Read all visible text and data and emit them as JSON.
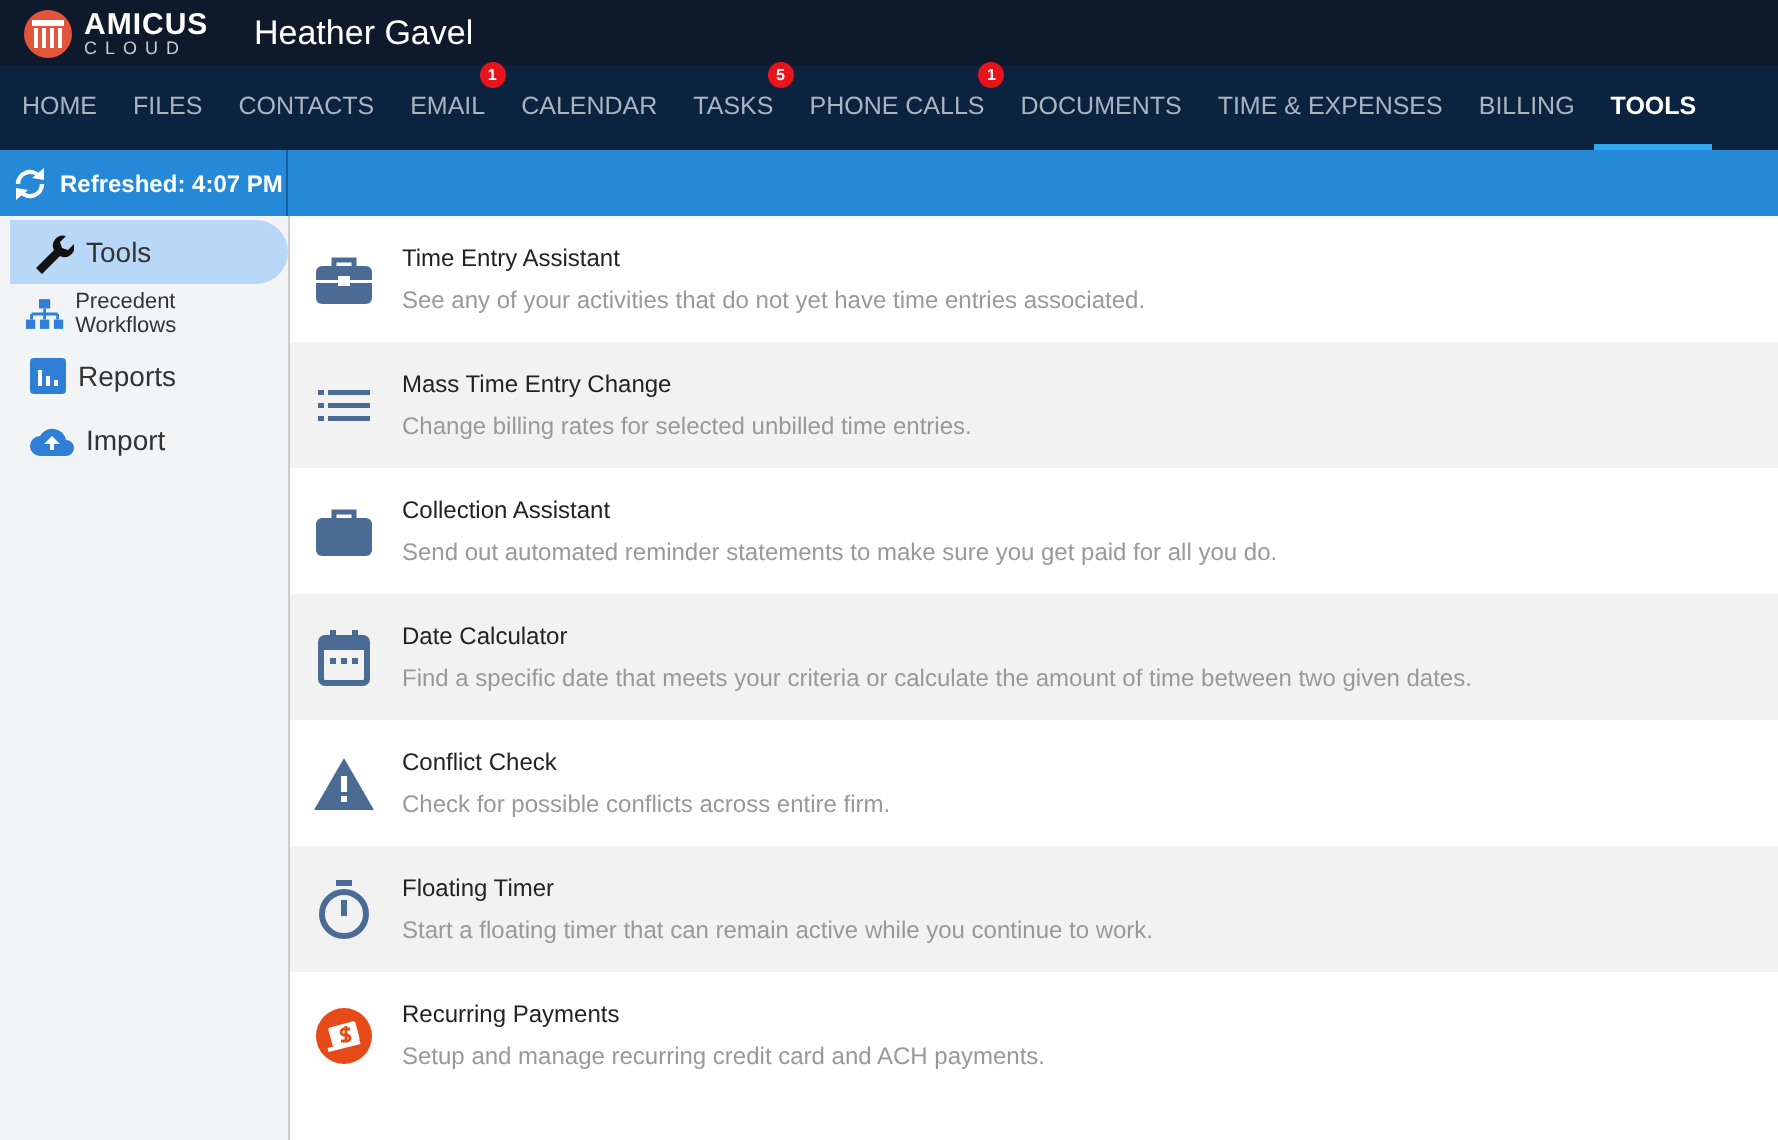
{
  "logo": {
    "name": "AMICUS",
    "sub": "CLOUD"
  },
  "user": "Heather Gavel",
  "tabs": [
    {
      "label": "HOME",
      "selected": false
    },
    {
      "label": "FILES",
      "selected": false
    },
    {
      "label": "CONTACTS",
      "selected": false
    },
    {
      "label": "EMAIL",
      "selected": false,
      "badge": "1"
    },
    {
      "label": "CALENDAR",
      "selected": false
    },
    {
      "label": "TASKS",
      "selected": false,
      "badge": "5"
    },
    {
      "label": "PHONE CALLS",
      "selected": false,
      "badge": "1"
    },
    {
      "label": "DOCUMENTS",
      "selected": false
    },
    {
      "label": "TIME & EXPENSES",
      "selected": false
    },
    {
      "label": "BILLING",
      "selected": false
    },
    {
      "label": "TOOLS",
      "selected": true
    }
  ],
  "refresh": "Refreshed: 4:07 PM",
  "sidebar": {
    "items": [
      {
        "label": "Tools",
        "kind": "wrench",
        "selected": true
      },
      {
        "label": "Precedent Workflows",
        "kind": "hierarchy",
        "selected": false
      },
      {
        "label": "Reports",
        "kind": "chart",
        "selected": false
      },
      {
        "label": "Import",
        "kind": "upload",
        "selected": false
      }
    ]
  },
  "tools": [
    {
      "title": "Time Entry Assistant",
      "description": "See any of your activities that do not yet have time entries associated.",
      "kind": "briefcase"
    },
    {
      "title": "Mass Time Entry Change",
      "description": "Change billing rates for selected unbilled time entries.",
      "kind": "list"
    },
    {
      "title": "Collection Assistant",
      "description": "Send out automated reminder statements to make sure you get paid for all you do.",
      "kind": "case"
    },
    {
      "title": "Date Calculator",
      "description": "Find a specific date that meets your criteria or calculate the amount of time between two given dates.",
      "kind": "calendar"
    },
    {
      "title": "Conflict Check",
      "description": "Check for possible conflicts across entire firm.",
      "kind": "warning"
    },
    {
      "title": "Floating Timer",
      "description": "Start a floating timer that can remain active while you continue to work.",
      "kind": "stopwatch"
    },
    {
      "title": "Recurring Payments",
      "description": "Setup and manage recurring credit card and ACH payments.",
      "kind": "payment"
    }
  ]
}
